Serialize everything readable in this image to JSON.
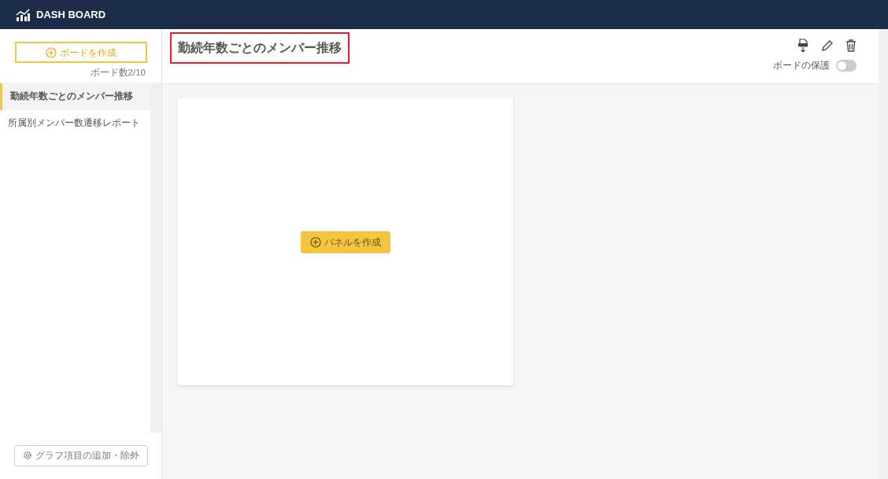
{
  "app": {
    "title": "DASH BOARD"
  },
  "sidebar": {
    "create_button": "ボードを作成",
    "board_count": "ボード数2/10",
    "items": [
      {
        "label": "勤続年数ごとのメンバー推移",
        "selected": true
      },
      {
        "label": "所属別メンバー数遷移レポート",
        "selected": false
      }
    ],
    "footer_button": "グラフ項目の追加・除外"
  },
  "board": {
    "title": "勤続年数ごとのメンバー推移",
    "title_highlighted": true,
    "protect_label": "ボードの保護",
    "protect_on": false,
    "panel_button": "パネルを作成"
  }
}
